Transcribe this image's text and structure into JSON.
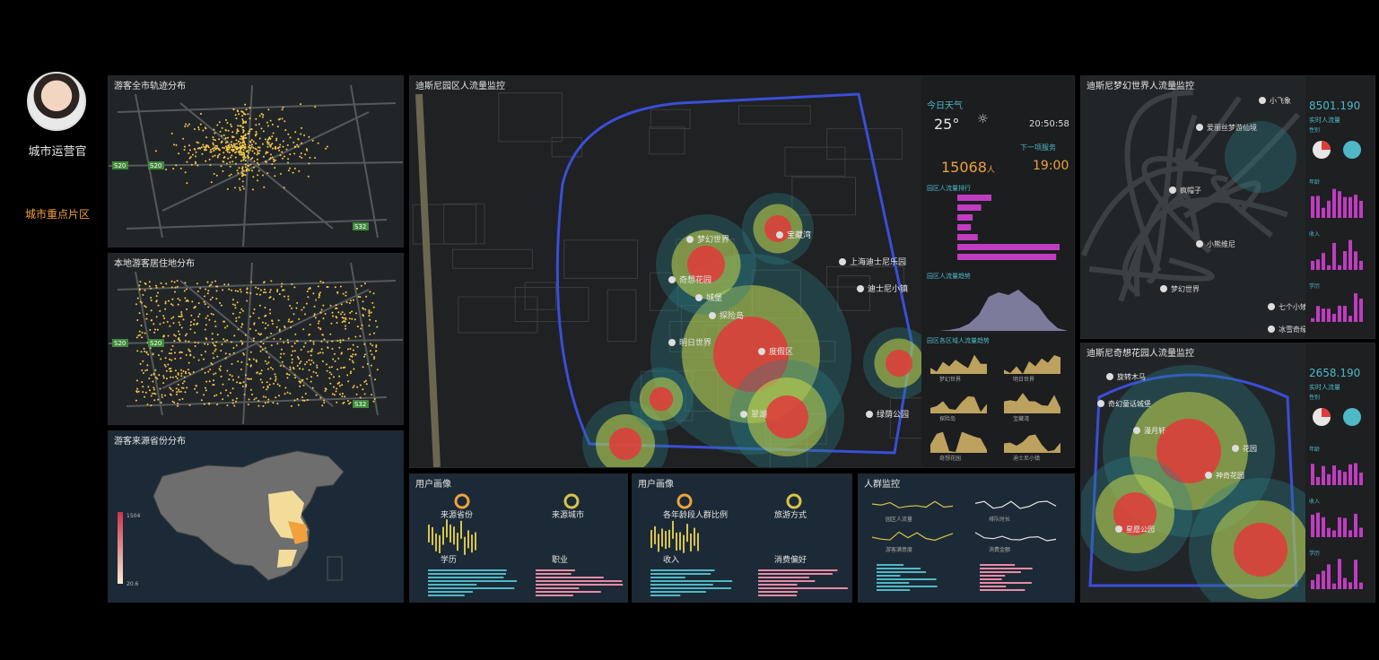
{
  "sidebar": {
    "role": "城市运营官",
    "menu_item": "城市重点片区"
  },
  "panels": {
    "tracks": "游客全市轨迹分布",
    "residence": "本地游客居住地分布",
    "province": "游客来源省份分布",
    "park": "迪斯尼园区人流量监控",
    "dream": "迪斯尼梦幻世界人流量监控",
    "garden": "迪斯尼奇想花园人流量监控",
    "profile1": "用户画像",
    "profile2": "用户画像",
    "crowd": "人群监控"
  },
  "map_labels": {
    "tracks": [
      "S20",
      "S20",
      "S32"
    ],
    "residence": [
      "S20",
      "S20",
      "S32"
    ],
    "park": [
      "梦幻世界",
      "奇想花园",
      "城堡",
      "明日世界",
      "探险岛",
      "宝藏湾",
      "上海迪士尼乐园",
      "迪士尼小镇",
      "度假区",
      "翠湖",
      "绿荫公园"
    ],
    "dream": [
      "小飞象",
      "爱丽丝梦游仙境",
      "疯帽子",
      "小熊维尼",
      "梦幻世界",
      "七个小矮人",
      "冰雪奇缘"
    ],
    "garden": [
      "旋转木马",
      "奇幻童话城堡",
      "漫月轩",
      "花园",
      "神奇花园",
      "星愿公园"
    ]
  },
  "weather": {
    "label": "今日天气",
    "temp": "25°",
    "time": "20:50:58",
    "next_label": "下一项服务",
    "count": "15068",
    "count_unit": "人",
    "clock": "19:00"
  },
  "mini_labels": {
    "bar_title": "园区人流量排行",
    "area_title": "园区人流量趋势",
    "small_title": "园区各区域人流量趋势",
    "small_names": [
      "梦幻世界",
      "明日世界",
      "探险岛",
      "宝藏湾",
      "奇想花园",
      "迪士尼小镇"
    ]
  },
  "dream_stats": {
    "big": "8501.190",
    "sub": "实时人流量",
    "rows": [
      "性别",
      "年龄",
      "收入",
      "学历"
    ]
  },
  "garden_stats": {
    "big": "2658.190",
    "sub": "实时人流量",
    "rows": [
      "性别",
      "年龄",
      "收入",
      "学历"
    ]
  },
  "profile1": {
    "labels": [
      "来源省份",
      "来源城市",
      "学历",
      "职业"
    ]
  },
  "profile2": {
    "labels": [
      "各年龄段人群比例",
      "旅游方式",
      "收入",
      "消费偏好"
    ]
  },
  "crowd": {
    "labels": [
      "园区人流量",
      "排队时长",
      "游客满意度",
      "消费金额"
    ]
  },
  "province_legend": {
    "max": "1504",
    "min": "20.6"
  },
  "colors": {
    "accent": "#f0a13b",
    "track": "#f5c94a",
    "pink": "#c03cc0",
    "teal": "#4fb8c6",
    "blue": "#3a4ed8"
  }
}
